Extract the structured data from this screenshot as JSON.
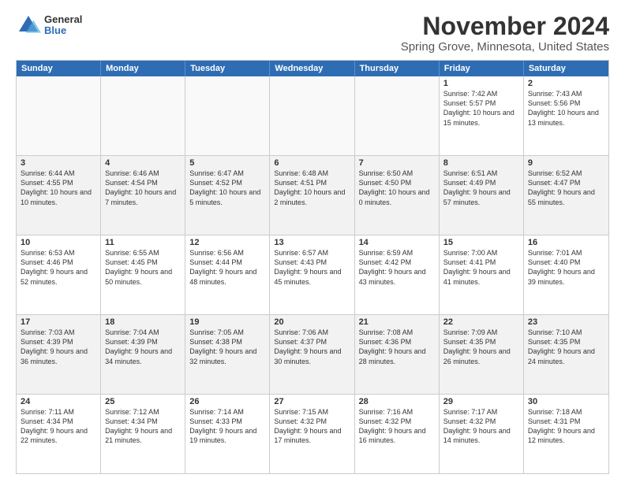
{
  "logo": {
    "general": "General",
    "blue": "Blue"
  },
  "title": "November 2024",
  "subtitle": "Spring Grove, Minnesota, United States",
  "headers": [
    "Sunday",
    "Monday",
    "Tuesday",
    "Wednesday",
    "Thursday",
    "Friday",
    "Saturday"
  ],
  "rows": [
    [
      {
        "day": "",
        "info": "",
        "empty": true
      },
      {
        "day": "",
        "info": "",
        "empty": true
      },
      {
        "day": "",
        "info": "",
        "empty": true
      },
      {
        "day": "",
        "info": "",
        "empty": true
      },
      {
        "day": "",
        "info": "",
        "empty": true
      },
      {
        "day": "1",
        "info": "Sunrise: 7:42 AM\nSunset: 5:57 PM\nDaylight: 10 hours and 15 minutes.",
        "empty": false
      },
      {
        "day": "2",
        "info": "Sunrise: 7:43 AM\nSunset: 5:56 PM\nDaylight: 10 hours and 13 minutes.",
        "empty": false
      }
    ],
    [
      {
        "day": "3",
        "info": "Sunrise: 6:44 AM\nSunset: 4:55 PM\nDaylight: 10 hours and 10 minutes.",
        "empty": false
      },
      {
        "day": "4",
        "info": "Sunrise: 6:46 AM\nSunset: 4:54 PM\nDaylight: 10 hours and 7 minutes.",
        "empty": false
      },
      {
        "day": "5",
        "info": "Sunrise: 6:47 AM\nSunset: 4:52 PM\nDaylight: 10 hours and 5 minutes.",
        "empty": false
      },
      {
        "day": "6",
        "info": "Sunrise: 6:48 AM\nSunset: 4:51 PM\nDaylight: 10 hours and 2 minutes.",
        "empty": false
      },
      {
        "day": "7",
        "info": "Sunrise: 6:50 AM\nSunset: 4:50 PM\nDaylight: 10 hours and 0 minutes.",
        "empty": false
      },
      {
        "day": "8",
        "info": "Sunrise: 6:51 AM\nSunset: 4:49 PM\nDaylight: 9 hours and 57 minutes.",
        "empty": false
      },
      {
        "day": "9",
        "info": "Sunrise: 6:52 AM\nSunset: 4:47 PM\nDaylight: 9 hours and 55 minutes.",
        "empty": false
      }
    ],
    [
      {
        "day": "10",
        "info": "Sunrise: 6:53 AM\nSunset: 4:46 PM\nDaylight: 9 hours and 52 minutes.",
        "empty": false
      },
      {
        "day": "11",
        "info": "Sunrise: 6:55 AM\nSunset: 4:45 PM\nDaylight: 9 hours and 50 minutes.",
        "empty": false
      },
      {
        "day": "12",
        "info": "Sunrise: 6:56 AM\nSunset: 4:44 PM\nDaylight: 9 hours and 48 minutes.",
        "empty": false
      },
      {
        "day": "13",
        "info": "Sunrise: 6:57 AM\nSunset: 4:43 PM\nDaylight: 9 hours and 45 minutes.",
        "empty": false
      },
      {
        "day": "14",
        "info": "Sunrise: 6:59 AM\nSunset: 4:42 PM\nDaylight: 9 hours and 43 minutes.",
        "empty": false
      },
      {
        "day": "15",
        "info": "Sunrise: 7:00 AM\nSunset: 4:41 PM\nDaylight: 9 hours and 41 minutes.",
        "empty": false
      },
      {
        "day": "16",
        "info": "Sunrise: 7:01 AM\nSunset: 4:40 PM\nDaylight: 9 hours and 39 minutes.",
        "empty": false
      }
    ],
    [
      {
        "day": "17",
        "info": "Sunrise: 7:03 AM\nSunset: 4:39 PM\nDaylight: 9 hours and 36 minutes.",
        "empty": false
      },
      {
        "day": "18",
        "info": "Sunrise: 7:04 AM\nSunset: 4:39 PM\nDaylight: 9 hours and 34 minutes.",
        "empty": false
      },
      {
        "day": "19",
        "info": "Sunrise: 7:05 AM\nSunset: 4:38 PM\nDaylight: 9 hours and 32 minutes.",
        "empty": false
      },
      {
        "day": "20",
        "info": "Sunrise: 7:06 AM\nSunset: 4:37 PM\nDaylight: 9 hours and 30 minutes.",
        "empty": false
      },
      {
        "day": "21",
        "info": "Sunrise: 7:08 AM\nSunset: 4:36 PM\nDaylight: 9 hours and 28 minutes.",
        "empty": false
      },
      {
        "day": "22",
        "info": "Sunrise: 7:09 AM\nSunset: 4:35 PM\nDaylight: 9 hours and 26 minutes.",
        "empty": false
      },
      {
        "day": "23",
        "info": "Sunrise: 7:10 AM\nSunset: 4:35 PM\nDaylight: 9 hours and 24 minutes.",
        "empty": false
      }
    ],
    [
      {
        "day": "24",
        "info": "Sunrise: 7:11 AM\nSunset: 4:34 PM\nDaylight: 9 hours and 22 minutes.",
        "empty": false
      },
      {
        "day": "25",
        "info": "Sunrise: 7:12 AM\nSunset: 4:34 PM\nDaylight: 9 hours and 21 minutes.",
        "empty": false
      },
      {
        "day": "26",
        "info": "Sunrise: 7:14 AM\nSunset: 4:33 PM\nDaylight: 9 hours and 19 minutes.",
        "empty": false
      },
      {
        "day": "27",
        "info": "Sunrise: 7:15 AM\nSunset: 4:32 PM\nDaylight: 9 hours and 17 minutes.",
        "empty": false
      },
      {
        "day": "28",
        "info": "Sunrise: 7:16 AM\nSunset: 4:32 PM\nDaylight: 9 hours and 16 minutes.",
        "empty": false
      },
      {
        "day": "29",
        "info": "Sunrise: 7:17 AM\nSunset: 4:32 PM\nDaylight: 9 hours and 14 minutes.",
        "empty": false
      },
      {
        "day": "30",
        "info": "Sunrise: 7:18 AM\nSunset: 4:31 PM\nDaylight: 9 hours and 12 minutes.",
        "empty": false
      }
    ]
  ]
}
